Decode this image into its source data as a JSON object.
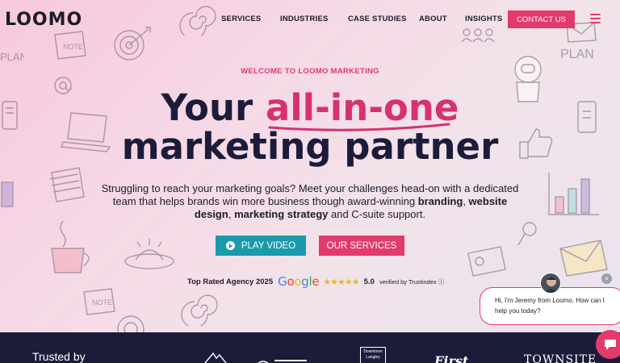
{
  "brand": {
    "logo_text": "LOOMO",
    "accent": "#e23a6d",
    "dark": "#1c1c3a",
    "teal": "#1b9aab"
  },
  "nav": {
    "items": [
      "SERVICES",
      "INDUSTRIES",
      "CASE STUDIES",
      "ABOUT",
      "INSIGHTS"
    ],
    "contact": "CONTACT US",
    "menu_icon": "hamburger-icon"
  },
  "hero": {
    "eyebrow": "WELCOME TO LOOMO MARKETING",
    "headline_prefix": "Your",
    "headline_accent": "all-in-one",
    "headline_line2": "marketing partner",
    "sub_part1": "Struggling to reach your marketing goals? Meet your challenges head-on with a dedicated team that helps brands win more business though award-winning ",
    "sub_bold1": "branding",
    "sub_part2": ", ",
    "sub_bold2": "website design",
    "sub_part3": ", ",
    "sub_bold3": "marketing strategy",
    "sub_part4": " and C-suite support.",
    "play_video": "PLAY VIDEO",
    "our_services": "OUR SERVICES"
  },
  "trust": {
    "top_rated": "Top Rated Agency 2025",
    "google": "Google",
    "stars": "★★★★★",
    "rating": "5.0",
    "verified": "verified by Trustindex ⓘ"
  },
  "chat": {
    "message": "Hi, I'm Jeremy from Loomo. How can I help you today?",
    "close": "×"
  },
  "trusted_band": {
    "label": "Trusted by",
    "logos": [
      "Downtown Langley",
      "First",
      "TOWNSITE"
    ]
  }
}
